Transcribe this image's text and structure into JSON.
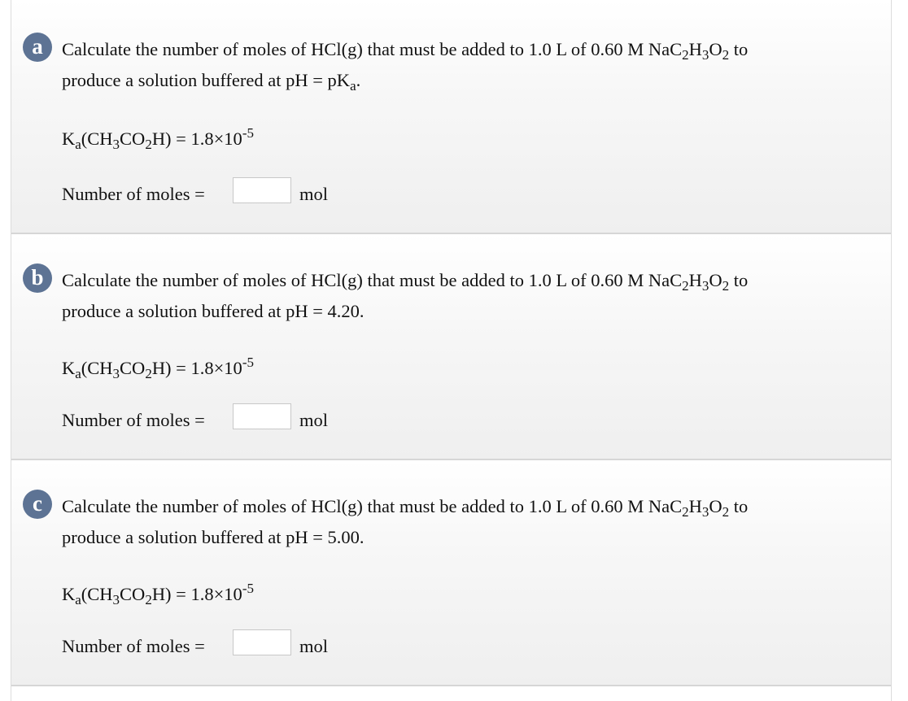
{
  "parts": [
    {
      "letter": "a",
      "line1_pre": "Calculate the number of moles of HCl(g) that must be added to 1.0 L of 0.60 M NaC",
      "line1_sub1": "2",
      "line1_mid1": "H",
      "line1_sub2": "3",
      "line1_mid2": "O",
      "line1_sub3": "2",
      "line1_post": " to",
      "line2_pre": "produce a solution buffered at pH = pK",
      "line2_sub": "a",
      "line2_post": ".",
      "ka": {
        "k": "K",
        "a": "a",
        "p1": "(CH",
        "s3": "3",
        "p2": "CO",
        "s2": "2",
        "p3": "H) = 1.8×10",
        "exp": "-5"
      },
      "answer_label": "Number of moles =",
      "answer_value": "",
      "unit": "mol"
    },
    {
      "letter": "b",
      "line1_pre": "Calculate the number of moles of HCl(g) that must be added to 1.0 L of 0.60 M NaC",
      "line1_sub1": "2",
      "line1_mid1": "H",
      "line1_sub2": "3",
      "line1_mid2": "O",
      "line1_sub3": "2",
      "line1_post": " to",
      "line2_pre": "produce a solution buffered at pH = 4.20.",
      "ka": {
        "k": "K",
        "a": "a",
        "p1": "(CH",
        "s3": "3",
        "p2": "CO",
        "s2": "2",
        "p3": "H) = 1.8×10",
        "exp": "-5"
      },
      "answer_label": "Number of moles =",
      "answer_value": "",
      "unit": "mol"
    },
    {
      "letter": "c",
      "line1_pre": "Calculate the number of moles of HCl(g) that must be added to 1.0 L of 0.60 M NaC",
      "line1_sub1": "2",
      "line1_mid1": "H",
      "line1_sub2": "3",
      "line1_mid2": "O",
      "line1_sub3": "2",
      "line1_post": " to",
      "line2_pre": "produce a solution buffered at pH = 5.00.",
      "ka": {
        "k": "K",
        "a": "a",
        "p1": "(CH",
        "s3": "3",
        "p2": "CO",
        "s2": "2",
        "p3": "H) = 1.8×10",
        "exp": "-5"
      },
      "answer_label": "Number of moles =",
      "answer_value": "",
      "unit": "mol"
    }
  ],
  "colors": {
    "badge": "#5d7394"
  }
}
